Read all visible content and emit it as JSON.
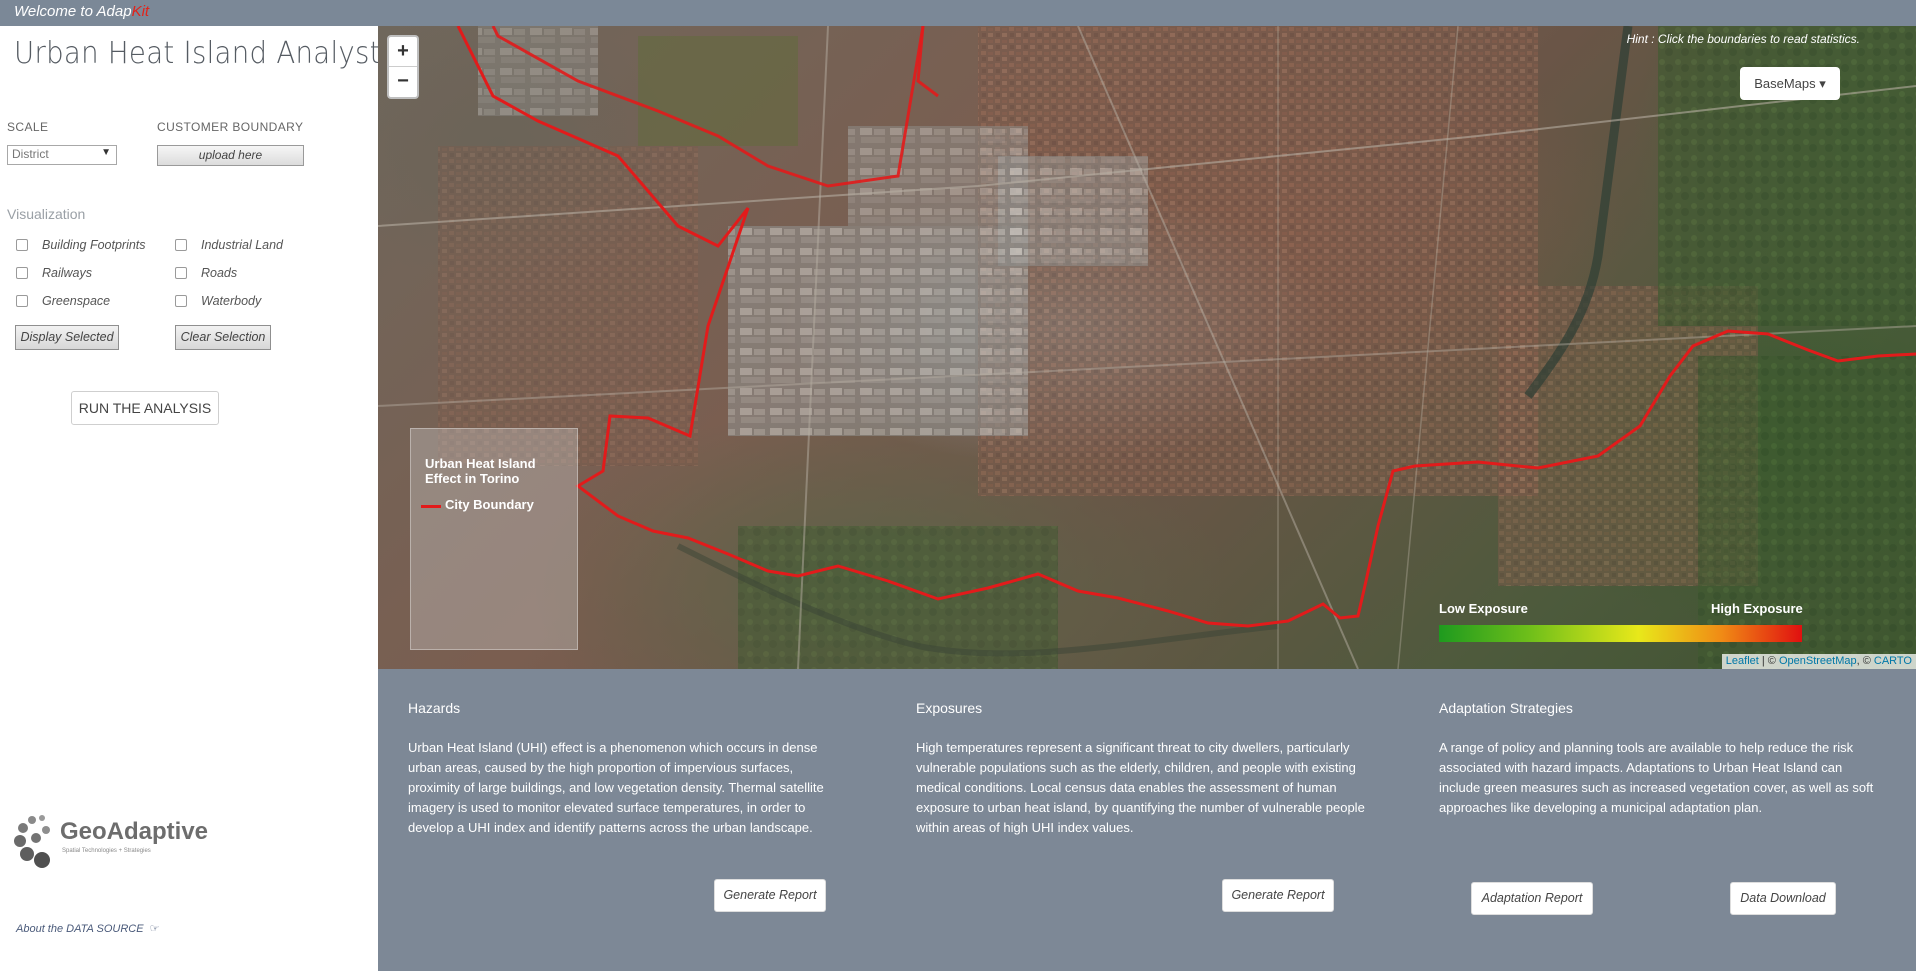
{
  "topbar": {
    "welcome_prefix": "Welcome to Adap",
    "welcome_accent": "Kit"
  },
  "sidebar": {
    "title": "Urban Heat Island Analyst",
    "scale_label": "SCALE",
    "scale_value": "District",
    "boundary_label": "CUSTOMER BOUNDARY",
    "upload_label": "upload here",
    "visualization_label": "Visualization",
    "layers": [
      {
        "label": "Building Footprints",
        "checked": false
      },
      {
        "label": "Industrial Land",
        "checked": false
      },
      {
        "label": "Railways",
        "checked": false
      },
      {
        "label": "Roads",
        "checked": false
      },
      {
        "label": "Greenspace",
        "checked": false
      },
      {
        "label": "Waterbody",
        "checked": false
      }
    ],
    "display_selected_label": "Display Selected",
    "clear_selection_label": "Clear Selection",
    "run_label": "RUN THE ANALYSIS",
    "logo_text": "GeoAdaptive",
    "logo_sub": "Spatial Technologies + Strategies",
    "data_source_label": "About the DATA SOURCE",
    "data_source_icon": "pointing-hand-icon"
  },
  "map": {
    "zoom_in": "+",
    "zoom_out": "−",
    "hint": "Hint : Click the boundaries to read statistics.",
    "basemaps_label": "BaseMaps ▾",
    "legend_title": "Urban Heat Island Effect in Torino",
    "legend_item": "City Boundary",
    "boundary_color": "#e21b1b",
    "exposure_low": "Low Exposure",
    "exposure_high": "High Exposure",
    "attribution_leaflet": "Leaflet",
    "attribution_sep1": " | © ",
    "attribution_osm": "OpenStreetMap",
    "attribution_sep2": ", © ",
    "attribution_carto": "CARTO"
  },
  "info": {
    "hazards_title": "Hazards",
    "hazards_text": "Urban Heat Island (UHI) effect is a phenomenon which occurs in dense urban areas, caused by the high proportion of impervious surfaces, proximity of large buildings, and low vegetation density. Thermal satellite imagery is used to monitor elevated surface temperatures, in order to develop a UHI index and identify patterns across the urban landscape.",
    "exposures_title": "Exposures",
    "exposures_text": "High temperatures represent a significant threat to city dwellers, particularly vulnerable populations such as the elderly, children, and people with existing medical conditions. Local census data enables the assessment of human exposure to urban heat island, by quantifying the number of vulnerable people within areas of high UHI index values.",
    "adaptation_title": "Adaptation Strategies",
    "adaptation_text": "A range of policy and planning tools are available to help reduce the risk associated with hazard impacts. Adaptations to Urban Heat Island can include green measures such as increased vegetation cover, as well as soft approaches like developing a municipal adaptation plan.",
    "generate_report_1": "Generate Report",
    "generate_report_2": "Generate Report",
    "adaptation_report": "Adaptation Report",
    "data_download": "Data Download"
  },
  "colors": {
    "topbar": "#7b8897",
    "info_panel": "#7d8896",
    "accent": "#e2231a"
  }
}
